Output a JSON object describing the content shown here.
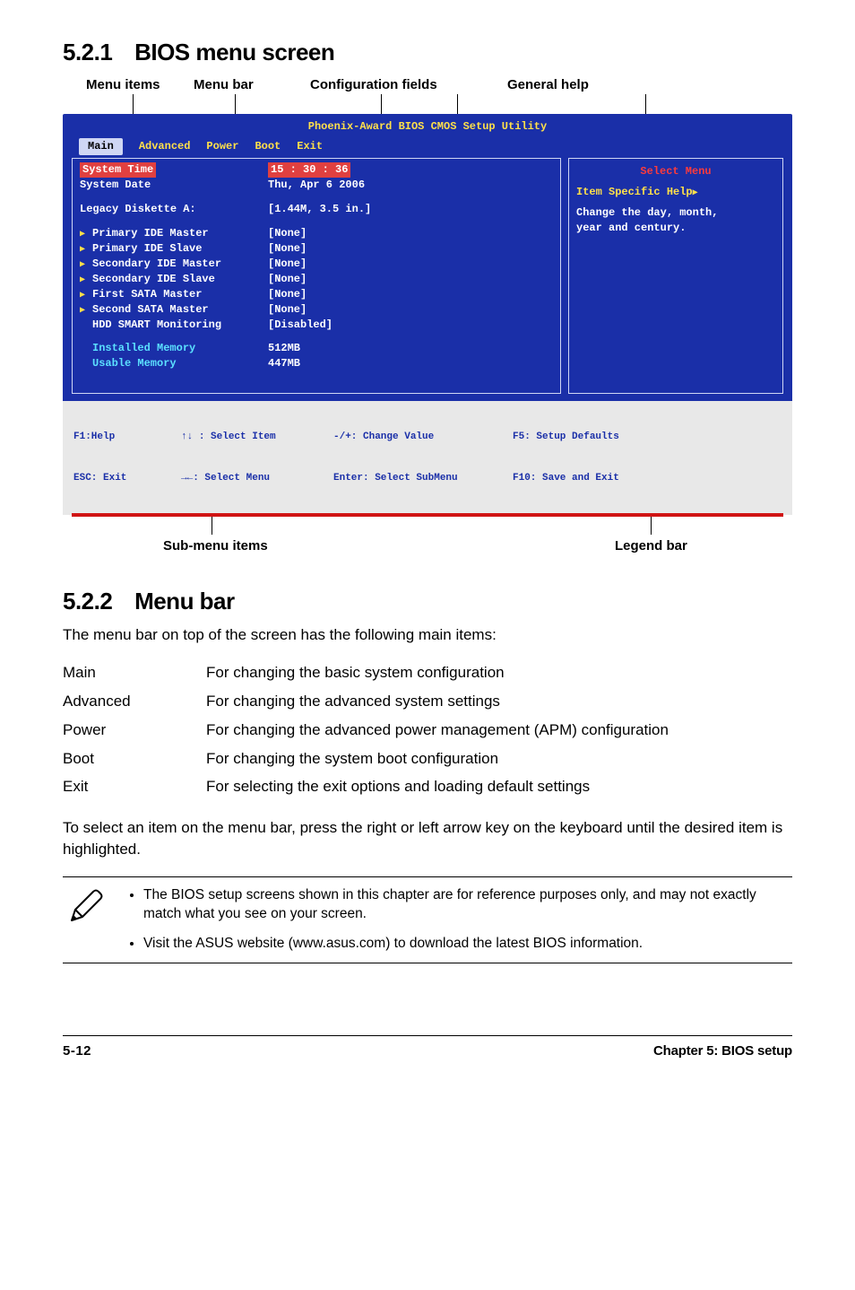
{
  "sec1": {
    "num": "5.2.1",
    "title": "BIOS menu screen"
  },
  "labels_top": {
    "menu_items": "Menu items",
    "menu_bar": "Menu bar",
    "config_fields": "Configuration fields",
    "general_help": "General help"
  },
  "bios": {
    "titlebar": "Phoenix-Award BIOS CMOS Setup Utility",
    "tabs": {
      "main": "Main",
      "advanced": "Advanced",
      "power": "Power",
      "boot": "Boot",
      "exit": "Exit"
    },
    "left": {
      "system_time_k": "System Time",
      "system_time_v": "15 : 30 : 36",
      "system_date_k": "System Date",
      "system_date_v": "Thu, Apr 6  2006",
      "legacy_k": "Legacy Diskette A:",
      "legacy_v": "[1.44M, 3.5 in.]",
      "pim_k": "Primary IDE Master",
      "pim_v": "[None]",
      "pis_k": "Primary IDE Slave",
      "pis_v": "[None]",
      "sim_k": "Secondary IDE Master",
      "sim_v": "[None]",
      "sis_k": "Secondary IDE Slave",
      "sis_v": "[None]",
      "fsm_k": "First SATA Master",
      "fsm_v": "[None]",
      "ssm_k": "Second SATA Master",
      "ssm_v": "[None]",
      "hdd_k": "HDD SMART Monitoring",
      "hdd_v": "[Disabled]",
      "imem_k": "Installed Memory",
      "imem_v": "512MB",
      "umem_k": "Usable Memory",
      "umem_v": "447MB"
    },
    "right": {
      "select_menu": "Select Menu",
      "item_help": "Item Specific Help",
      "tri": "▶",
      "msg1": "Change the day, month,",
      "msg2": "year and century."
    },
    "footer": {
      "f1": "F1:Help",
      "esc": "ESC: Exit",
      "selitem": ": Select Item",
      "selmenu": ": Select Menu",
      "chval": "-/+: Change Value",
      "entersub": "Enter: Select SubMenu",
      "f5": "F5: Setup Defaults",
      "f10": "F10: Save and Exit",
      "arrows_ud": "↑↓",
      "arrows_lr": "→←"
    }
  },
  "labels_bottom": {
    "sub_items": "Sub-menu items",
    "legend": "Legend bar"
  },
  "sec2": {
    "num": "5.2.2",
    "title": "Menu bar"
  },
  "intro": "The menu bar on top of the screen has the following main items:",
  "table": {
    "main_k": "Main",
    "main_v": "For changing the basic system configuration",
    "adv_k": "Advanced",
    "adv_v": "For changing the advanced system settings",
    "pow_k": "Power",
    "pow_v": "For changing the advanced power management (APM) configuration",
    "boot_k": "Boot",
    "boot_v": "For changing the system boot configuration",
    "exit_k": "Exit",
    "exit_v": "For selecting the exit options and loading default settings"
  },
  "outro": "To select an item on the menu bar, press the right or left arrow key on the keyboard until the desired item is highlighted.",
  "notes": {
    "n1": "The BIOS setup screens shown in this chapter are for reference purposes only, and may not exactly match what you see on your screen.",
    "n2": "Visit the ASUS website (www.asus.com) to download the latest BIOS information."
  },
  "footer": {
    "page": "5-12",
    "chapter": "Chapter 5: BIOS setup"
  }
}
